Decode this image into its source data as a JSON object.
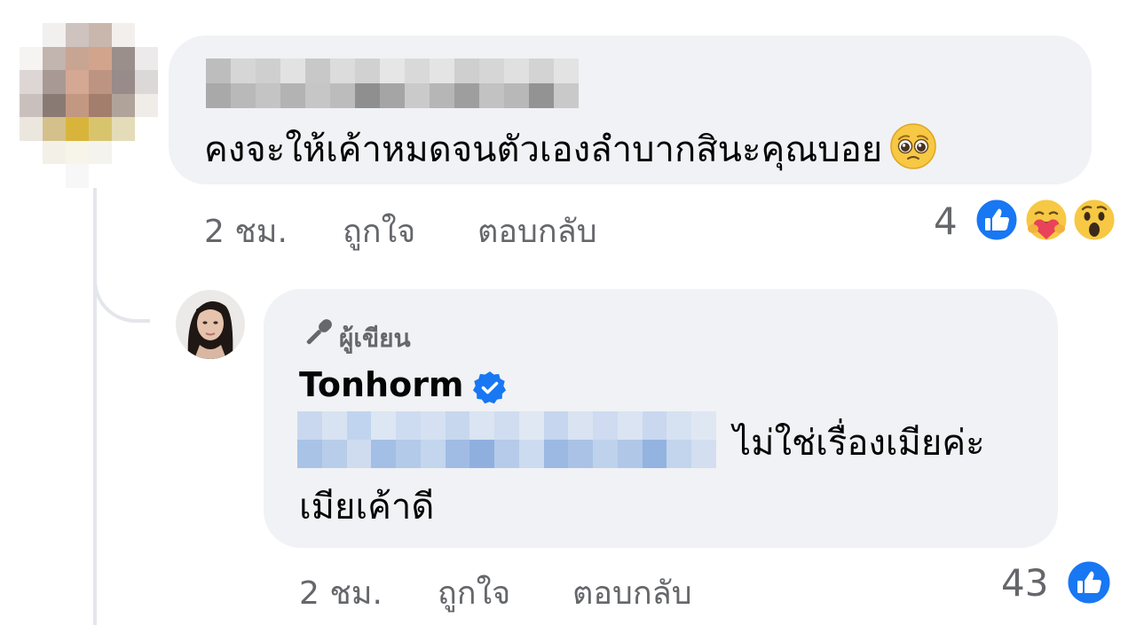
{
  "comment1": {
    "text": "คงจะให้เค้าหมดจนตัวเองลำบากสินะคุณบอย",
    "time": "2 ชม.",
    "like_label": "ถูกใจ",
    "reply_label": "ตอบกลับ",
    "reaction_count": "4",
    "reactions": [
      "like-icon",
      "care-icon",
      "wow-icon"
    ],
    "emoji": "pleading-face-icon"
  },
  "comment2": {
    "badge_label": "ผู้เขียน",
    "author": "Tonhorm",
    "text_line1": "ไม่ใช่เรื่องเมียค่ะ",
    "text_line2": "เมียเค้าดี",
    "time": "2 ชม.",
    "like_label": "ถูกใจ",
    "reply_label": "ตอบกลับ",
    "reaction_count": "43",
    "reactions": [
      "like-icon"
    ]
  },
  "colors": {
    "bubble": "#f0f2f5",
    "meta_text": "#65676b",
    "facebook_blue": "#1877f2",
    "mention_blue_pixels": "#b8cdea"
  }
}
